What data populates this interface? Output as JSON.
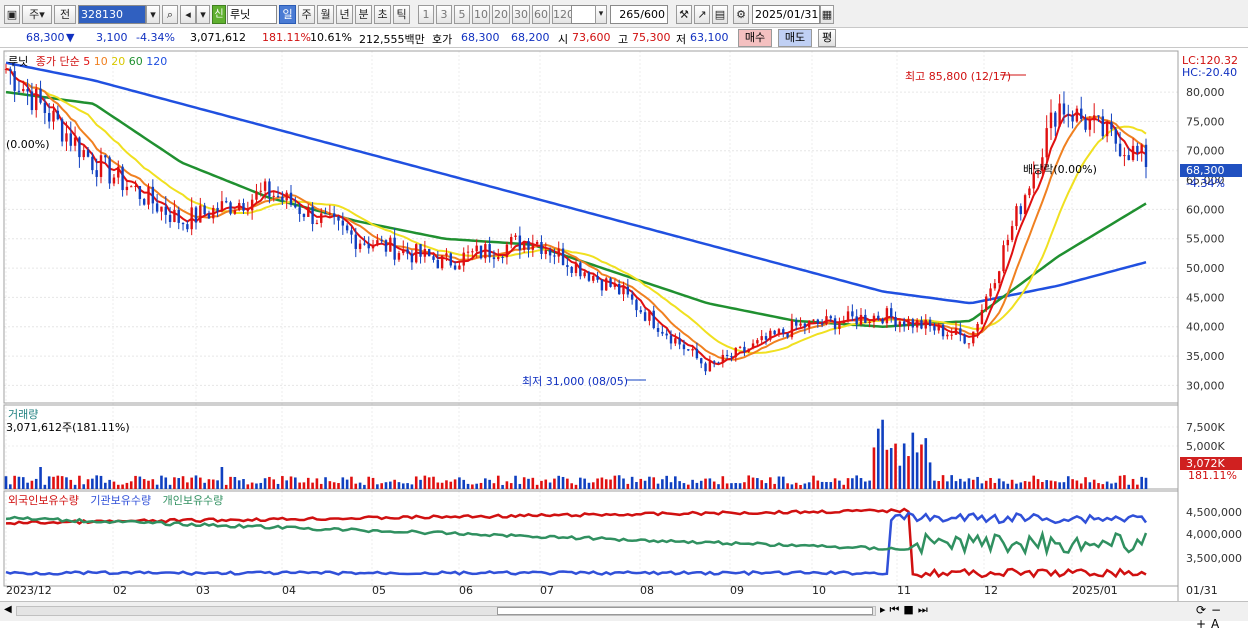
{
  "toolbar": {
    "mode": "주",
    "prefix": "전",
    "code": "328130",
    "stock_badge": "신",
    "stock_name": "루닛",
    "periods": [
      "일",
      "주",
      "월",
      "년",
      "분",
      "초",
      "틱"
    ],
    "minutes": [
      "1",
      "3",
      "5",
      "10",
      "20",
      "30",
      "60",
      "120"
    ],
    "count": "265",
    "total": "/600",
    "date": "2025/01/31"
  },
  "quote": {
    "price": "68,300",
    "arrow": "▼",
    "change": "3,100",
    "pct": "-4.34%",
    "volume": "3,071,612",
    "vol_ratio": "181.11%",
    "turnover": "10.61%",
    "mcap": "212,555백만",
    "ask_label": "호가",
    "ask": "68,300",
    "bid": "68,200",
    "open_label": "시",
    "open": "73,600",
    "high_label": "고",
    "high": "75,300",
    "low_label": "저",
    "low": "63,100",
    "buy": "매수",
    "sell": "매도",
    "eval": "평"
  },
  "price_panel": {
    "legend_name": "루닛",
    "legend_ma_label": "종가 단순",
    "ma_periods": [
      "5",
      "10",
      "20",
      "60",
      "120"
    ],
    "lc": "LC:120.32",
    "hc": "HC:-20.40",
    "high_note": "최고 85,800 (12/17)",
    "low_note": "최저 31,000 (08/05)",
    "start_note": "(0.00%)",
    "div_note": "배당락(0.00%)",
    "current_price": "68,300",
    "current_pct": "-4.34%"
  },
  "volume_panel": {
    "title": "거래량",
    "value": "3,071,612주(181.11%)",
    "current": "3,072K",
    "current_pct": "181.11%"
  },
  "holdings_panel": {
    "series": [
      "외국인보유수량",
      "기관보유수량",
      "개인보유수량"
    ]
  },
  "xaxis": {
    "labels": [
      "2023/12",
      "02",
      "03",
      "04",
      "05",
      "06",
      "07",
      "08",
      "09",
      "10",
      "11",
      "12",
      "2025/01"
    ],
    "right_label": "01/31"
  },
  "chart_data": [
    {
      "type": "candlestick",
      "title": "루닛",
      "ylim": [
        27000,
        87000
      ],
      "yticks": [
        30000,
        35000,
        40000,
        45000,
        50000,
        55000,
        60000,
        65000,
        70000,
        75000,
        80000
      ],
      "x": [
        "2023-12",
        "2024-01",
        "2024-02",
        "2024-03",
        "2024-04",
        "2024-05",
        "2024-06",
        "2024-07",
        "2024-08",
        "2024-09",
        "2024-10",
        "2024-11",
        "2024-12",
        "2025-01"
      ],
      "close": [
        84000,
        68000,
        58000,
        63000,
        55000,
        51000,
        55000,
        46000,
        33000,
        40000,
        42000,
        38000,
        78000,
        68300
      ],
      "series": [
        {
          "name": "5",
          "color": "#e01010"
        },
        {
          "name": "10",
          "color": "#f08020"
        },
        {
          "name": "20",
          "color": "#f0e020"
        },
        {
          "name": "60",
          "color": "#209030"
        },
        {
          "name": "120",
          "color": "#2050e0"
        }
      ],
      "ma60": [
        80000,
        78000,
        68000,
        62000,
        58000,
        55000,
        54000,
        49000,
        44000,
        41000,
        40000,
        41000,
        52000,
        61000
      ],
      "ma120": [
        85000,
        82000,
        78000,
        74000,
        70000,
        66000,
        62000,
        58000,
        54000,
        50000,
        46000,
        44000,
        47000,
        51000
      ],
      "annotations": [
        {
          "text": "최고 85,800 (12/17)",
          "value": 85800
        },
        {
          "text": "최저 31,000 (08/05)",
          "value": 31000
        }
      ]
    },
    {
      "type": "bar",
      "title": "거래량",
      "yticks": [
        "5,000K",
        "7,500K"
      ],
      "current": 3072
    },
    {
      "type": "line",
      "series": [
        {
          "name": "외국인보유수량",
          "color": "#d01010"
        },
        {
          "name": "기관보유수량",
          "color": "#3050d8"
        },
        {
          "name": "개인보유수량",
          "color": "#309060"
        }
      ],
      "yticks": [
        "3,500,000",
        "4,000,000",
        "4,500,000"
      ]
    }
  ]
}
